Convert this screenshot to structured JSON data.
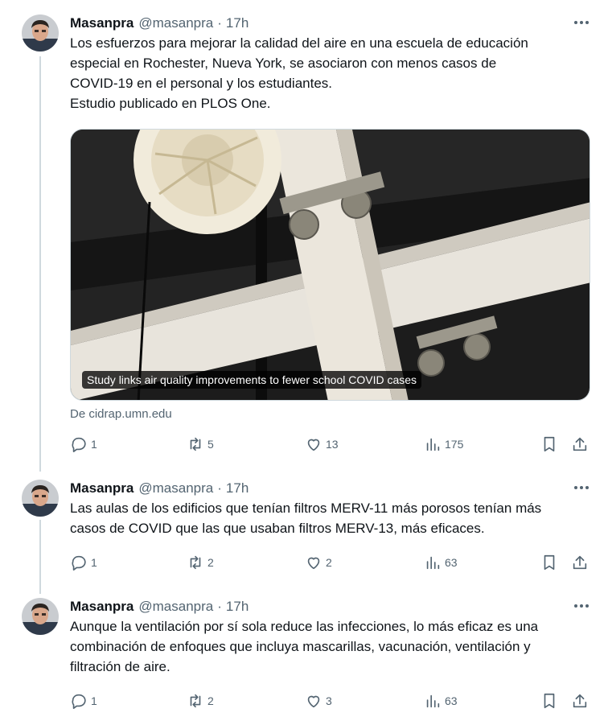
{
  "tweets": [
    {
      "name": "Masanpra",
      "handle": "@masanpra",
      "time": "17h",
      "lines": [
        "Los esfuerzos para mejorar la calidad del aire en una escuela de educación",
        "especial en Rochester, Nueva York, se asociaron con menos casos de",
        "COVID-19 en el personal y los estudiantes.",
        "Estudio publicado en PLOS One."
      ],
      "card": {
        "caption": "Study links air quality improvements to fewer school COVID cases",
        "source": "De cidrap.umn.edu"
      },
      "replies": "1",
      "retweets": "5",
      "likes": "13",
      "views": "175"
    },
    {
      "name": "Masanpra",
      "handle": "@masanpra",
      "time": "17h",
      "lines": [
        "Las aulas de los edificios que tenían filtros MERV-11 más porosos tenían más",
        "casos de COVID que las que usaban filtros MERV-13, más eficaces."
      ],
      "replies": "1",
      "retweets": "2",
      "likes": "2",
      "views": "63"
    },
    {
      "name": "Masanpra",
      "handle": "@masanpra",
      "time": "17h",
      "lines": [
        "Aunque la ventilación por sí sola reduce las infecciones, lo más eficaz es una",
        "combinación de enfoques que incluya mascarillas, vacunación, ventilación y",
        "filtración de aire."
      ],
      "replies": "1",
      "retweets": "2",
      "likes": "3",
      "views": "63"
    }
  ],
  "separator": "·",
  "icons": [
    "reply-icon",
    "retweet-icon",
    "like-icon",
    "views-icon",
    "bookmark-icon",
    "share-icon",
    "more-icon"
  ],
  "colors": {
    "text": "#0f1419",
    "muted": "#536471",
    "thread_line": "#cfd9de"
  }
}
